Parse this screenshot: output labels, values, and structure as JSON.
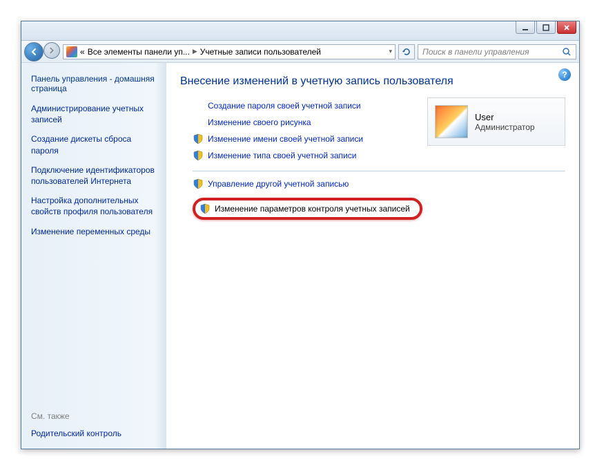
{
  "titlebar": {},
  "nav": {
    "breadcrumb_prefix": "«",
    "breadcrumb1": "Все элементы панели уп...",
    "breadcrumb2": "Учетные записи пользователей",
    "search_placeholder": "Поиск в панели управления"
  },
  "sidebar": {
    "home": "Панель управления - домашняя страница",
    "links": [
      "Администрирование учетных записей",
      "Создание дискеты сброса пароля",
      "Подключение идентификаторов пользователей Интернета",
      "Настройка дополнительных свойств профиля пользователя",
      "Изменение переменных среды"
    ],
    "seealso_label": "См. также",
    "seealso1": "Родительский контроль"
  },
  "content": {
    "heading": "Внесение изменений в учетную запись пользователя",
    "tasks": [
      "Создание пароля своей учетной записи",
      "Изменение своего рисунка",
      "Изменение имени своей учетной записи",
      "Изменение типа своей учетной записи"
    ],
    "tasks2": [
      "Управление другой учетной записью",
      "Изменение параметров контроля учетных записей"
    ]
  },
  "userbox": {
    "name": "User",
    "role": "Администратор"
  }
}
